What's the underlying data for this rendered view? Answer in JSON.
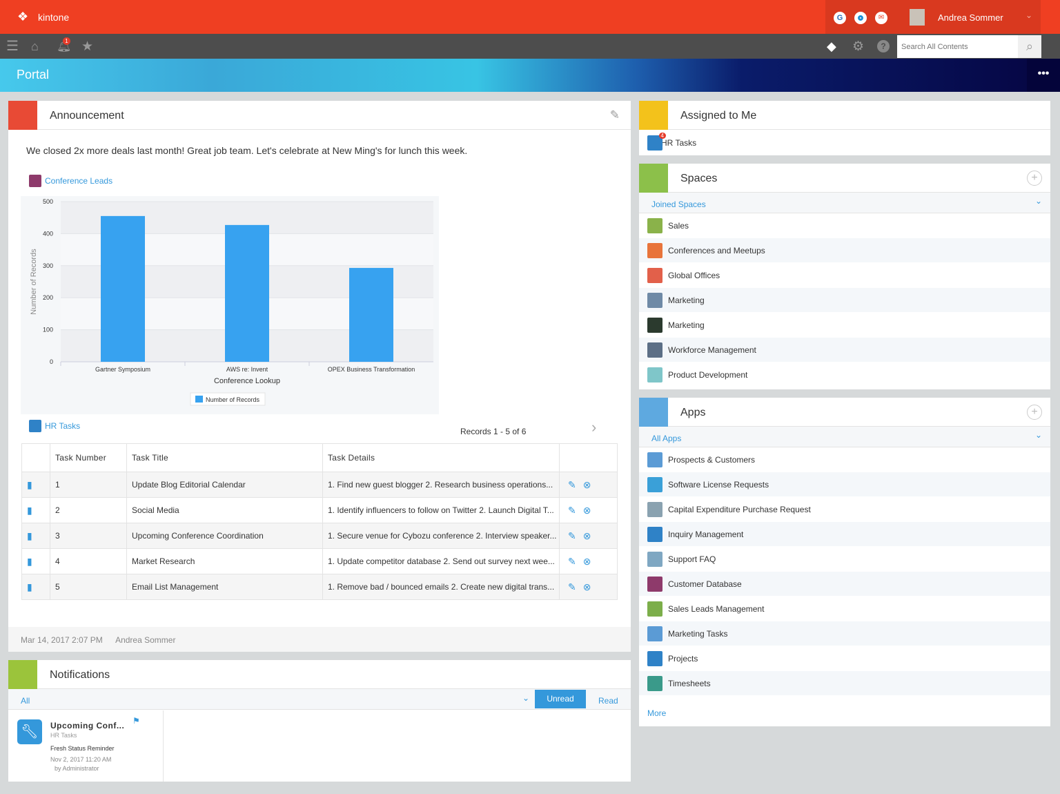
{
  "header": {
    "logo": "kintone",
    "user": "Andrea Sommer",
    "search_placeholder": "Search All Contents",
    "notification_count": "1"
  },
  "banner": {
    "title": "Portal"
  },
  "announcement": {
    "title": "Announcement",
    "message": "We closed 2x more deals last month! Great job team. Let's celebrate at New Ming's for lunch this week.",
    "chart_app": "Conference Leads",
    "table_app": "HR Tasks",
    "records": "Records 1 - 5  of 6",
    "footer_date": "Mar 14, 2017 2:07 PM",
    "footer_user": "Andrea Sommer"
  },
  "chart_data": {
    "type": "bar",
    "categories": [
      "Gartner Symposium",
      "AWS re: Invent",
      "OPEX Business Transformation"
    ],
    "series": [
      {
        "name": "Number of Records",
        "values": [
          455,
          427,
          293
        ]
      }
    ],
    "xlabel": "Conference Lookup",
    "ylabel": "Number of Records",
    "ylim": [
      0,
      500
    ],
    "yticks": [
      "0",
      "100",
      "200",
      "300",
      "400",
      "500"
    ],
    "grid": true,
    "legend": "bottom",
    "color": "#37a2f0"
  },
  "table": {
    "headers": [
      "Task Number",
      "Task Title",
      "Task Details"
    ],
    "rows": [
      {
        "num": "1",
        "title": "Update Blog Editorial Calendar",
        "details": "1. Find new guest blogger  2. Research business operations..."
      },
      {
        "num": "2",
        "title": "Social Media",
        "details": "1. Identify influencers to follow on Twitter 2. Launch Digital T..."
      },
      {
        "num": "3",
        "title": "Upcoming Conference Coordination",
        "details": "1. Secure venue for Cybozu conference 2. Interview speaker..."
      },
      {
        "num": "4",
        "title": "Market Research",
        "details": "1. Update competitor database 2. Send out survey next wee..."
      },
      {
        "num": "5",
        "title": "Email List Management",
        "details": "1. Remove bad / bounced emails 2. Create new digital trans..."
      }
    ]
  },
  "notifications": {
    "title": "Notifications",
    "filter": "All",
    "unread": "Unread",
    "read": "Read",
    "item": {
      "title": "Upcoming Conf...",
      "app": "HR Tasks",
      "text": "Fresh Status Reminder",
      "date": "Nov 2, 2017 11:20 AM",
      "by": "by Administrator"
    }
  },
  "assigned": {
    "title": "Assigned to Me",
    "items": [
      {
        "label": "HR Tasks",
        "badge": "4"
      }
    ]
  },
  "spaces": {
    "title": "Spaces",
    "filter": "Joined Spaces",
    "items": [
      {
        "label": "Sales",
        "color": "#8ab24a"
      },
      {
        "label": "Conferences and Meetups",
        "color": "#e8743b"
      },
      {
        "label": "Global Offices",
        "color": "#e2604a"
      },
      {
        "label": "Marketing",
        "color": "#6f8aa6"
      },
      {
        "label": "Marketing",
        "color": "#2b3a2e"
      },
      {
        "label": "Workforce Management",
        "color": "#5c6f86"
      },
      {
        "label": "Product Development",
        "color": "#7fc6c9"
      }
    ]
  },
  "apps": {
    "title": "Apps",
    "filter": "All Apps",
    "more": "More",
    "items": [
      {
        "label": "Prospects & Customers",
        "color": "#5b9bd5"
      },
      {
        "label": "Software License Requests",
        "color": "#3aa0d8"
      },
      {
        "label": "Capital Expenditure Purchase Request",
        "color": "#8aa2b0"
      },
      {
        "label": "Inquiry Management",
        "color": "#2f82c7"
      },
      {
        "label": "Support FAQ",
        "color": "#7fa7c2"
      },
      {
        "label": "Customer Database",
        "color": "#8e3a6b"
      },
      {
        "label": "Sales Leads Management",
        "color": "#7cae4a"
      },
      {
        "label": "Marketing Tasks",
        "color": "#5b9bd5"
      },
      {
        "label": "Projects",
        "color": "#2f82c7"
      },
      {
        "label": "Timesheets",
        "color": "#3a9a8a"
      }
    ]
  }
}
